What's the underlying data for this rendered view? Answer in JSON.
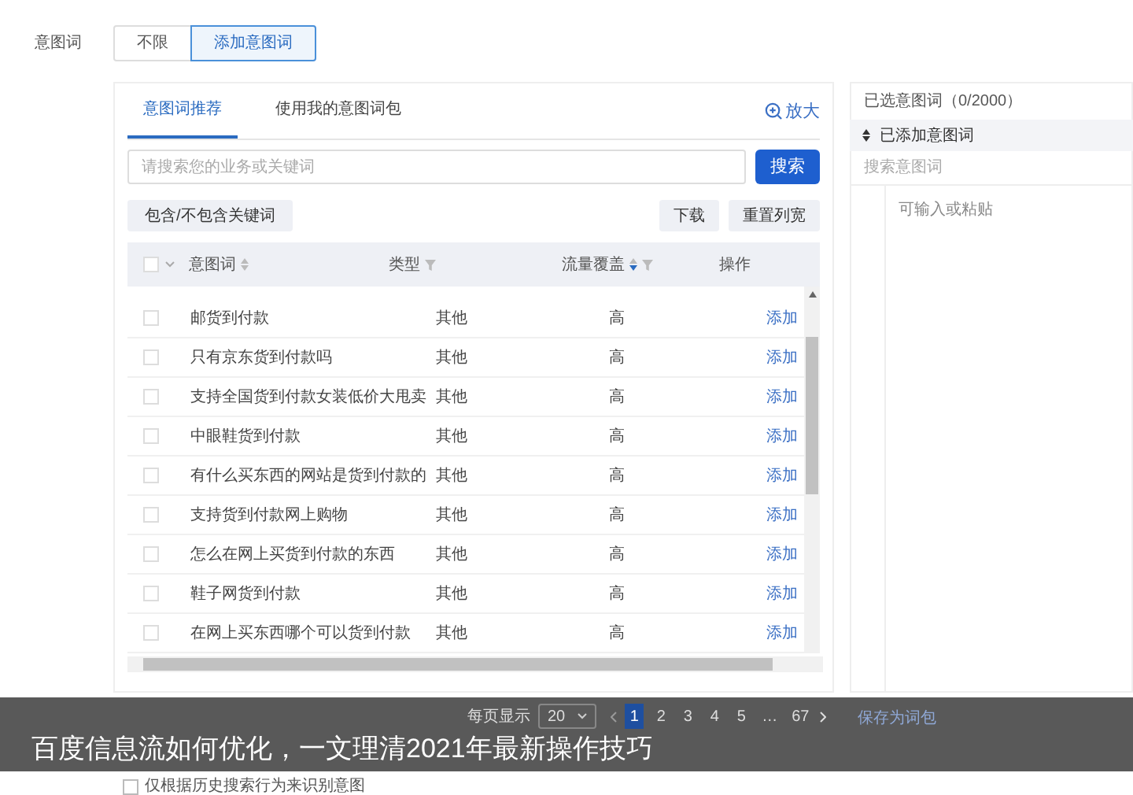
{
  "field_label": "意图词",
  "mode_options": [
    {
      "label": "不限",
      "selected": false
    },
    {
      "label": "添加意图词",
      "selected": true
    }
  ],
  "left_panel": {
    "tabs": [
      {
        "label": "意图词推荐",
        "selected": true
      },
      {
        "label": "使用我的意图词包",
        "selected": false
      }
    ],
    "zoom_link": "放大",
    "search": {
      "placeholder": "请搜索您的业务或关键词",
      "button": "搜索"
    },
    "filter_button": "包含/不包含关键词",
    "buttons": [
      "下载",
      "重置列宽"
    ],
    "table": {
      "select_all_checked": false,
      "columns": [
        {
          "label": "意图词",
          "sortable": true,
          "filterable": false
        },
        {
          "label": "类型",
          "sortable": false,
          "filterable": true
        },
        {
          "label": "流量覆盖",
          "sortable": true,
          "filterable": true
        },
        {
          "label": "操作",
          "sortable": false,
          "filterable": false
        }
      ],
      "rows": [
        {
          "keyword": "邮货到付款",
          "type": "其他",
          "traffic": "高",
          "action": "添加",
          "checked": false
        },
        {
          "keyword": "只有京东货到付款吗",
          "type": "其他",
          "traffic": "高",
          "action": "添加",
          "checked": false
        },
        {
          "keyword": "支持全国货到付款女装低价大甩卖",
          "type": "其他",
          "traffic": "高",
          "action": "添加",
          "checked": false
        },
        {
          "keyword": "中眼鞋货到付款",
          "type": "其他",
          "traffic": "高",
          "action": "添加",
          "checked": false
        },
        {
          "keyword": "有什么买东西的网站是货到付款的",
          "type": "其他",
          "traffic": "高",
          "action": "添加",
          "checked": false
        },
        {
          "keyword": "支持货到付款网上购物",
          "type": "其他",
          "traffic": "高",
          "action": "添加",
          "checked": false
        },
        {
          "keyword": "怎么在网上买货到付款的东西",
          "type": "其他",
          "traffic": "高",
          "action": "添加",
          "checked": false
        },
        {
          "keyword": "鞋子网货到付款",
          "type": "其他",
          "traffic": "高",
          "action": "添加",
          "checked": false
        },
        {
          "keyword": "在网上买东西哪个可以货到付款",
          "type": "其他",
          "traffic": "高",
          "action": "添加",
          "checked": false
        }
      ]
    },
    "pagination": {
      "page_size_label": "每页显示",
      "page_size": "20",
      "pages": [
        {
          "label": "1",
          "selected": true
        },
        {
          "label": "2",
          "selected": false
        },
        {
          "label": "3",
          "selected": false
        },
        {
          "label": "4",
          "selected": false
        },
        {
          "label": "5",
          "selected": false
        },
        {
          "label": "…",
          "selected": false
        },
        {
          "label": "67",
          "selected": false
        }
      ]
    }
  },
  "right_panel": {
    "title": "已选意图词（0/2000）",
    "section": "已添加意图词",
    "search_placeholder": "搜索意图词",
    "input_placeholder": "可输入或粘贴",
    "save_link": "保存为词包"
  },
  "history_option": {
    "label": "仅根据历史搜索行为来识别意图",
    "checked": false
  },
  "caption": "百度信息流如何优化，一文理清2021年最新操作技巧"
}
